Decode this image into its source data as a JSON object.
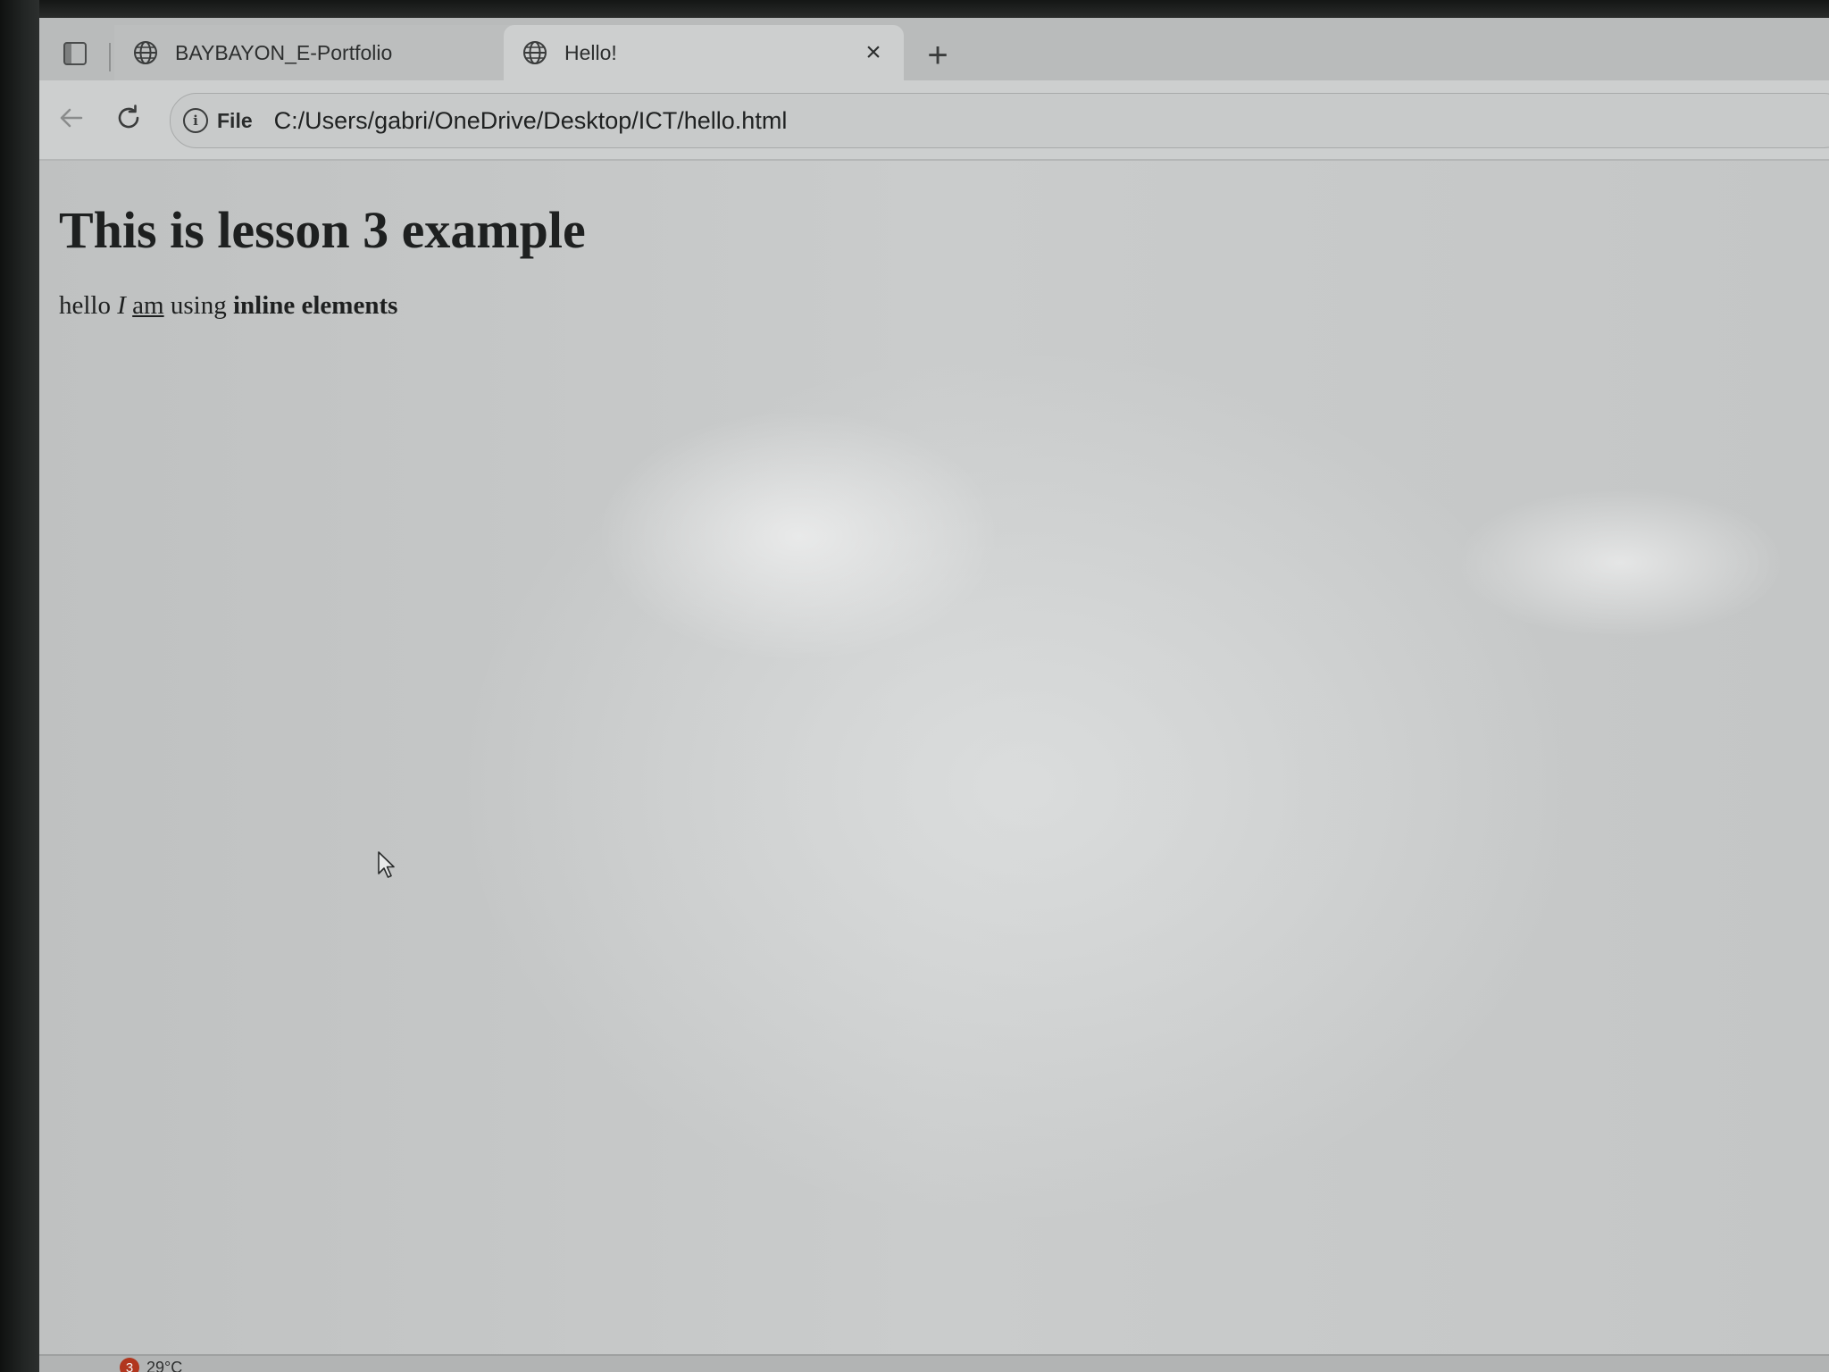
{
  "browser": {
    "tabs": [
      {
        "title": "BAYBAYON_E-Portfolio",
        "active": false
      },
      {
        "title": "Hello!",
        "active": true
      }
    ],
    "address_bar": {
      "scheme_label": "File",
      "url": "C:/Users/gabri/OneDrive/Desktop/ICT/hello.html"
    }
  },
  "page": {
    "heading": "This is lesson 3 example",
    "paragraph": {
      "plain_1": "hello ",
      "italic": "I",
      "space_1": " ",
      "underlined": "am",
      "plain_2": " using ",
      "bold": "inline elements"
    }
  },
  "taskbar": {
    "notification_count": "3",
    "temperature": "29°C"
  },
  "icons": {
    "tab_actions": "tab-actions-icon",
    "tab_globe": "globe-icon",
    "close": "close-icon",
    "new_tab": "plus-icon",
    "back": "back-arrow-icon",
    "reload": "reload-icon",
    "site_info": "info-icon",
    "cursor": "mouse-pointer-icon"
  },
  "colors": {
    "page_background": "#c6c8c8",
    "text": "#1e2020",
    "badge": "#b1361e"
  }
}
